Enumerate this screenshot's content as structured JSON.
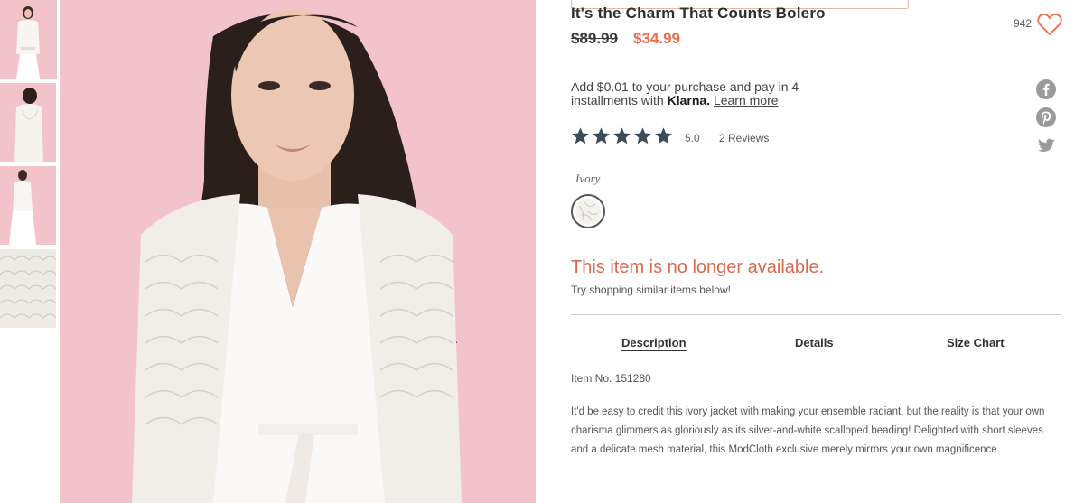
{
  "product": {
    "title": "It's the Charm That Counts Bolero",
    "price_old": "$89.99",
    "price_new": "$34.99",
    "favorites_count": "942"
  },
  "klarna": {
    "text": "Add $0.01 to your purchase and pay in 4 installments with",
    "brand": "Klarna.",
    "link": "Learn more"
  },
  "rating": {
    "value": "5.0",
    "stars": 5,
    "separator": "|",
    "reviews": "2 Reviews"
  },
  "color": {
    "label": "Ivory"
  },
  "availability": {
    "message": "This item is no longer available.",
    "sub": "Try shopping similar items below!"
  },
  "tabs": [
    {
      "label": "Description"
    },
    {
      "label": "Details"
    },
    {
      "label": "Size Chart"
    }
  ],
  "description": {
    "item_no": "Item No. 151280",
    "text": "It'd be easy to credit this ivory jacket with making your ensemble radiant, but the reality is that your own charisma glimmers as gloriously as its silver-and-white scalloped beading! Delighted with short sleeves and a delicate mesh material, this ModCloth exclusive merely mirrors your own magnificence."
  },
  "share": {
    "icons": [
      "facebook-icon",
      "pinterest-icon",
      "twitter-icon"
    ]
  },
  "colors": {
    "sale": "#ee6b4b",
    "unavailable": "#d86a4e",
    "star": "#3e4a5a",
    "background_pink": "#f2c3cb"
  }
}
